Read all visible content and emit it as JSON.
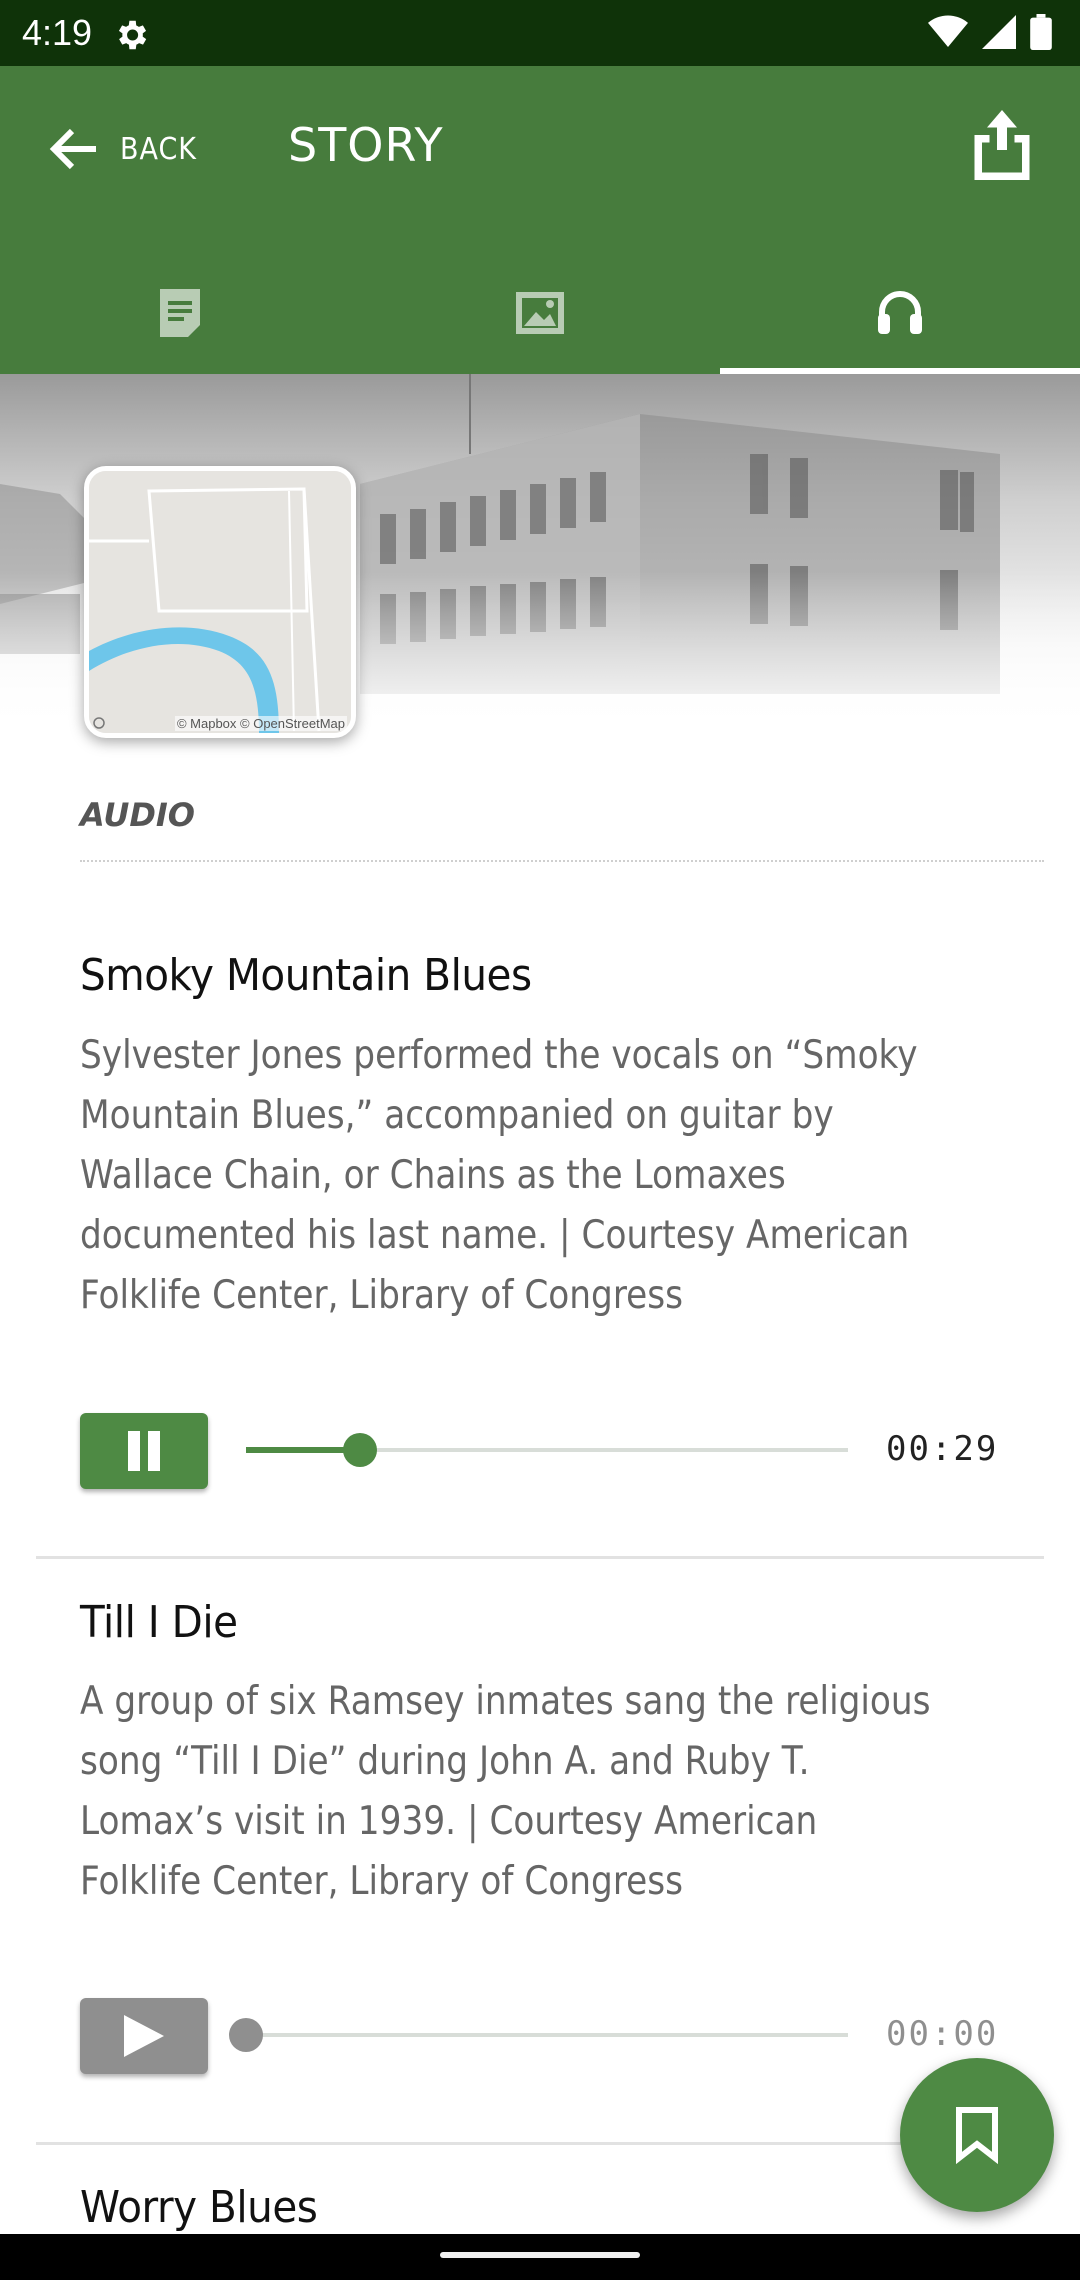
{
  "status_bar": {
    "time": "4:19"
  },
  "header": {
    "back_label": "BACK",
    "title": "STORY"
  },
  "tabs": [
    {
      "icon": "document-icon",
      "active": false
    },
    {
      "icon": "image-icon",
      "active": false
    },
    {
      "icon": "headphones-icon",
      "active": true
    }
  ],
  "map": {
    "attribution": "© Mapbox © OpenStreetMap"
  },
  "section": {
    "label": "AUDIO"
  },
  "tracks": [
    {
      "title": "Smoky Mountain Blues",
      "description": "Sylvester Jones performed the vocals on “Smoky Mountain Blues,” accompanied on guitar by Wallace Chain, or Chains as the Lomaxes documented his last name. | Courtesy American Folklife Center, Library of Congress",
      "time": "00:29",
      "playing": true,
      "progress": 0.19
    },
    {
      "title": "Till I Die",
      "description": "A group of six Ramsey inmates sang the religious song “Till I Die” during John A. and Ruby T. Lomax’s visit in 1939. | Courtesy American Folklife Center, Library of Congress",
      "time": "00:00",
      "playing": false,
      "progress": 0
    },
    {
      "title": "Worry Blues"
    }
  ],
  "colors": {
    "accent": "#4e8a44",
    "header": "#477c3d",
    "status_bar": "#0f3309",
    "inactive": "#8f8f8f"
  }
}
